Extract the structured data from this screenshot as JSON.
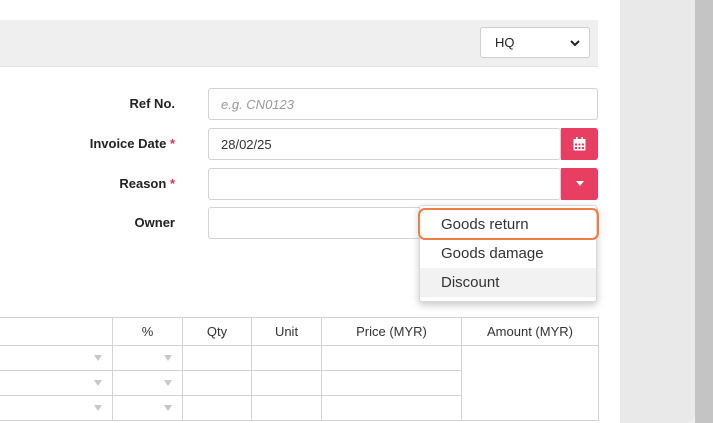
{
  "branch_select": {
    "value": "HQ"
  },
  "form": {
    "ref_no": {
      "label": "Ref No.",
      "placeholder": "e.g. CN0123"
    },
    "invoice_date": {
      "label": "Invoice Date",
      "required_mark": "*",
      "value": "28/02/25"
    },
    "reason": {
      "label": "Reason",
      "required_mark": "*",
      "value": ""
    },
    "owner": {
      "label": "Owner",
      "value": ""
    }
  },
  "reason_dropdown": {
    "options": [
      "Goods return",
      "Goods damage",
      "Discount"
    ],
    "highlighted": "Discount",
    "focused": "Goods return"
  },
  "table": {
    "headers": [
      "%",
      "Qty",
      "Unit",
      "Price (MYR)",
      "Amount (MYR)"
    ]
  },
  "colors": {
    "accent": "#e83e62",
    "focus_ring": "#f07c45"
  }
}
